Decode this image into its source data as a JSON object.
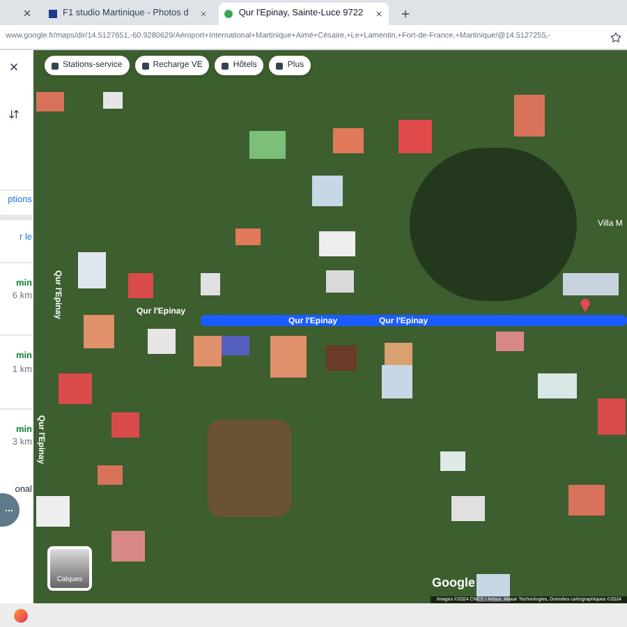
{
  "browser": {
    "tabs": [
      {
        "title": "F1 studio Martinique - Photos d",
        "selected": false
      },
      {
        "title": "Qur l'Epinay, Sainte-Luce 9722",
        "selected": true
      }
    ],
    "url": "www.google.fr/maps/dir/14.5127651,-60.9280629/Aéroport+International+Martinique+Aimé+Césaire,+Le+Lamentin,+Fort-de-France,+Martinique/@14.5127255,-"
  },
  "sidebar": {
    "options_link": "ptions",
    "link_2": "r le",
    "routes": [
      {
        "time": "min",
        "distance": "6 km"
      },
      {
        "time": "min",
        "distance": "1 km"
      },
      {
        "time": "min",
        "distance": "3 km"
      }
    ],
    "text": "onal"
  },
  "map": {
    "chips": [
      "Stations-service",
      "Recharge VE",
      "Hôtels",
      "Plus"
    ],
    "road_labels": [
      "Qur l'Epinay",
      "Qur l'Epinay",
      "Qur l'Epinay"
    ],
    "vertical_labels": [
      "Qur l'Epinay",
      "Qur l'Epinay"
    ],
    "place_label": "Villa M",
    "layers_label": "Calques",
    "logo": "Google",
    "attribution": "Images ©2024 CNES / Airbus, Maxar Technologies, Données cartographiques ©2024"
  }
}
